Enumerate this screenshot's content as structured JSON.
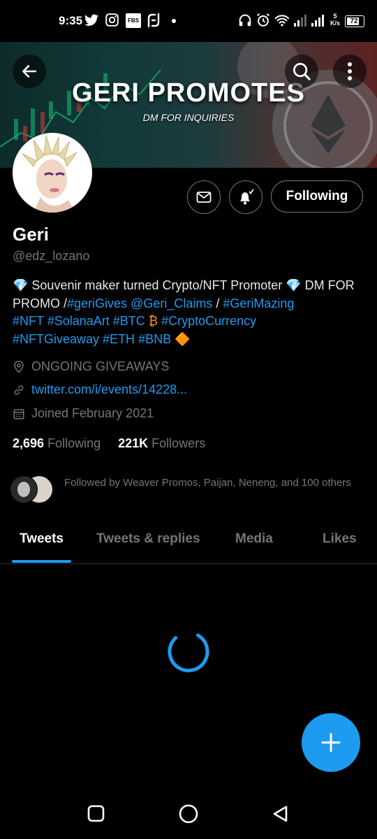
{
  "status_bar": {
    "time": "9:35",
    "network_speed": "5\nK/s",
    "battery": "72",
    "left_icons": [
      "twitter-icon",
      "instagram-icon",
      "fbs-icon",
      "app-icon",
      "dot-icon"
    ],
    "fbs_label": "FBS"
  },
  "banner": {
    "title": "GERI PROMOTES",
    "subtitle": "DM FOR INQUIRIES"
  },
  "profile": {
    "name": "Geri",
    "handle": "@edz_lozano",
    "follow_label": "Following",
    "bio": {
      "p1": "💎 Souvenir maker turned Crypto/NFT Promoter 💎 DM FOR PROMO /",
      "l1": "#geriGives",
      "s1": " ",
      "l2": "@Geri_Claims",
      "s2": " / ",
      "l3": "#GeriMazing",
      "l4": "#NFT",
      "l5": "#SolanaArt",
      "l6": "#BTC",
      "p2": " ₿  ",
      "l7": "#CryptoCurrency",
      "l8": "#NFTGiveaway",
      "l9": "#ETH",
      "l10": "#BNB",
      "p3": " 🔶"
    },
    "location": "ONGOING GIVEAWAYS",
    "website": "twitter.com/i/events/14228...",
    "joined": "Joined February 2021",
    "following_count": "2,696",
    "following_label": "Following",
    "followers_count": "221K",
    "followers_label": "Followers",
    "followed_by": "Followed by Weaver Promos, Paijan, Neneng, and 100 others"
  },
  "tabs": [
    "Tweets",
    "Tweets & replies",
    "Media",
    "Likes"
  ],
  "active_tab": "Tweets",
  "colors": {
    "accent": "#1d9bf0",
    "background": "#000000",
    "muted": "#71767b"
  }
}
